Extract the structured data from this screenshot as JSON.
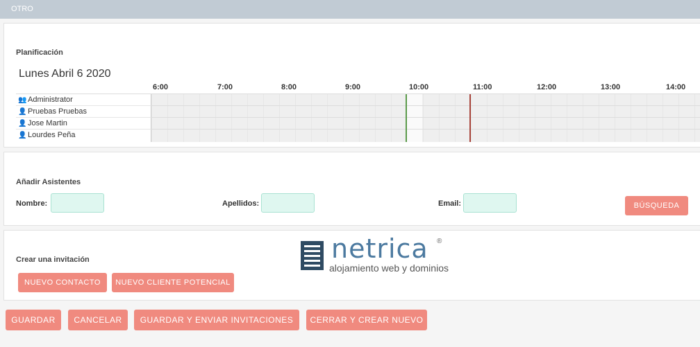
{
  "section_header": "OTRO",
  "planning": {
    "label": "Planificación",
    "date_title": "Lunes Abril 6 2020",
    "hours": [
      "6:00",
      "7:00",
      "8:00",
      "9:00",
      "10:00",
      "11:00",
      "12:00",
      "13:00",
      "14:00"
    ],
    "people": [
      {
        "name": "Administrator",
        "icon": "users-icon"
      },
      {
        "name": "Pruebas Pruebas",
        "icon": "user-icon"
      },
      {
        "name": "Jose Martin",
        "icon": "user-icon"
      },
      {
        "name": "Lourdes Peña",
        "icon": "user-icon"
      }
    ],
    "marker_colors": {
      "start": "#5a9a4a",
      "end": "#a8433a"
    }
  },
  "attendees": {
    "label": "Añadir Asistentes",
    "nombre_label": "Nombre:",
    "nombre_value": "",
    "apellidos_label": "Apellidos:",
    "apellidos_value": "",
    "email_label": "Email:",
    "email_value": "",
    "search_button": "BÚSQUEDA"
  },
  "invite": {
    "label": "Crear una invitación",
    "new_contact_button": "NUEVO CONTACTO",
    "new_lead_button": "NUEVO CLIENTE POTENCIAL"
  },
  "logo": {
    "word": "netrica",
    "registered": "®",
    "tagline": "alojamiento web y dominios"
  },
  "actions": {
    "save": "GUARDAR",
    "cancel": "CANCELAR",
    "save_send": "GUARDAR Y ENVIAR INVITACIONES",
    "close_new": "CERRAR Y CREAR NUEVO"
  },
  "colors": {
    "accent_button": "#f08a7f",
    "input_bg": "#dff7f0",
    "header_bg": "#c1cbd4"
  }
}
